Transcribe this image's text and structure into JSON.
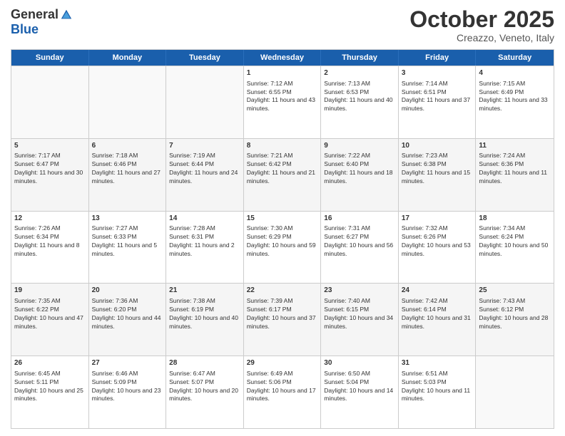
{
  "logo": {
    "general": "General",
    "blue": "Blue"
  },
  "title": "October 2025",
  "subtitle": "Creazzo, Veneto, Italy",
  "days": [
    "Sunday",
    "Monday",
    "Tuesday",
    "Wednesday",
    "Thursday",
    "Friday",
    "Saturday"
  ],
  "rows": [
    [
      {
        "day": "",
        "empty": true
      },
      {
        "day": "",
        "empty": true
      },
      {
        "day": "",
        "empty": true
      },
      {
        "day": "1",
        "sunrise": "7:12 AM",
        "sunset": "6:55 PM",
        "daylight": "11 hours and 43 minutes."
      },
      {
        "day": "2",
        "sunrise": "7:13 AM",
        "sunset": "6:53 PM",
        "daylight": "11 hours and 40 minutes."
      },
      {
        "day": "3",
        "sunrise": "7:14 AM",
        "sunset": "6:51 PM",
        "daylight": "11 hours and 37 minutes."
      },
      {
        "day": "4",
        "sunrise": "7:15 AM",
        "sunset": "6:49 PM",
        "daylight": "11 hours and 33 minutes."
      }
    ],
    [
      {
        "day": "5",
        "sunrise": "7:17 AM",
        "sunset": "6:47 PM",
        "daylight": "11 hours and 30 minutes."
      },
      {
        "day": "6",
        "sunrise": "7:18 AM",
        "sunset": "6:46 PM",
        "daylight": "11 hours and 27 minutes."
      },
      {
        "day": "7",
        "sunrise": "7:19 AM",
        "sunset": "6:44 PM",
        "daylight": "11 hours and 24 minutes."
      },
      {
        "day": "8",
        "sunrise": "7:21 AM",
        "sunset": "6:42 PM",
        "daylight": "11 hours and 21 minutes."
      },
      {
        "day": "9",
        "sunrise": "7:22 AM",
        "sunset": "6:40 PM",
        "daylight": "11 hours and 18 minutes."
      },
      {
        "day": "10",
        "sunrise": "7:23 AM",
        "sunset": "6:38 PM",
        "daylight": "11 hours and 15 minutes."
      },
      {
        "day": "11",
        "sunrise": "7:24 AM",
        "sunset": "6:36 PM",
        "daylight": "11 hours and 11 minutes."
      }
    ],
    [
      {
        "day": "12",
        "sunrise": "7:26 AM",
        "sunset": "6:34 PM",
        "daylight": "11 hours and 8 minutes."
      },
      {
        "day": "13",
        "sunrise": "7:27 AM",
        "sunset": "6:33 PM",
        "daylight": "11 hours and 5 minutes."
      },
      {
        "day": "14",
        "sunrise": "7:28 AM",
        "sunset": "6:31 PM",
        "daylight": "11 hours and 2 minutes."
      },
      {
        "day": "15",
        "sunrise": "7:30 AM",
        "sunset": "6:29 PM",
        "daylight": "10 hours and 59 minutes."
      },
      {
        "day": "16",
        "sunrise": "7:31 AM",
        "sunset": "6:27 PM",
        "daylight": "10 hours and 56 minutes."
      },
      {
        "day": "17",
        "sunrise": "7:32 AM",
        "sunset": "6:26 PM",
        "daylight": "10 hours and 53 minutes."
      },
      {
        "day": "18",
        "sunrise": "7:34 AM",
        "sunset": "6:24 PM",
        "daylight": "10 hours and 50 minutes."
      }
    ],
    [
      {
        "day": "19",
        "sunrise": "7:35 AM",
        "sunset": "6:22 PM",
        "daylight": "10 hours and 47 minutes."
      },
      {
        "day": "20",
        "sunrise": "7:36 AM",
        "sunset": "6:20 PM",
        "daylight": "10 hours and 44 minutes."
      },
      {
        "day": "21",
        "sunrise": "7:38 AM",
        "sunset": "6:19 PM",
        "daylight": "10 hours and 40 minutes."
      },
      {
        "day": "22",
        "sunrise": "7:39 AM",
        "sunset": "6:17 PM",
        "daylight": "10 hours and 37 minutes."
      },
      {
        "day": "23",
        "sunrise": "7:40 AM",
        "sunset": "6:15 PM",
        "daylight": "10 hours and 34 minutes."
      },
      {
        "day": "24",
        "sunrise": "7:42 AM",
        "sunset": "6:14 PM",
        "daylight": "10 hours and 31 minutes."
      },
      {
        "day": "25",
        "sunrise": "7:43 AM",
        "sunset": "6:12 PM",
        "daylight": "10 hours and 28 minutes."
      }
    ],
    [
      {
        "day": "26",
        "sunrise": "6:45 AM",
        "sunset": "5:11 PM",
        "daylight": "10 hours and 25 minutes."
      },
      {
        "day": "27",
        "sunrise": "6:46 AM",
        "sunset": "5:09 PM",
        "daylight": "10 hours and 23 minutes."
      },
      {
        "day": "28",
        "sunrise": "6:47 AM",
        "sunset": "5:07 PM",
        "daylight": "10 hours and 20 minutes."
      },
      {
        "day": "29",
        "sunrise": "6:49 AM",
        "sunset": "5:06 PM",
        "daylight": "10 hours and 17 minutes."
      },
      {
        "day": "30",
        "sunrise": "6:50 AM",
        "sunset": "5:04 PM",
        "daylight": "10 hours and 14 minutes."
      },
      {
        "day": "31",
        "sunrise": "6:51 AM",
        "sunset": "5:03 PM",
        "daylight": "10 hours and 11 minutes."
      },
      {
        "day": "",
        "empty": true
      }
    ]
  ]
}
